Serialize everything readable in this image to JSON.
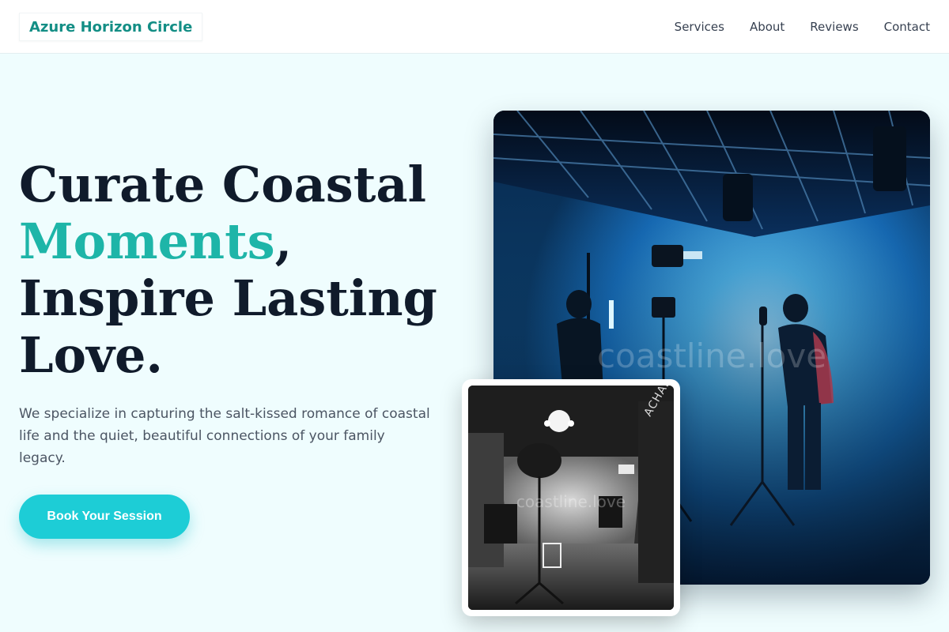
{
  "header": {
    "brand": "Azure Horizon Circle",
    "nav": [
      "Services",
      "About",
      "Reviews",
      "Contact"
    ]
  },
  "hero": {
    "title_line1": "Curate Coastal",
    "title_accent": "Moments",
    "title_comma": ",",
    "title_line3": "Inspire Lasting",
    "title_line4": "Love.",
    "description": "We specialize in capturing the salt-kissed romance of coastal life and the quiet, beautiful connections of your family legacy.",
    "cta": "Book Your Session"
  },
  "images": {
    "main_watermark": "coastline.love",
    "small_watermark": "coastline.love",
    "small_wall_text": "ACHARKI STUD"
  },
  "colors": {
    "accent": "#1eb5a8",
    "brand": "#138e85",
    "cta": "#1dcdd6",
    "background": "#effdfe"
  }
}
